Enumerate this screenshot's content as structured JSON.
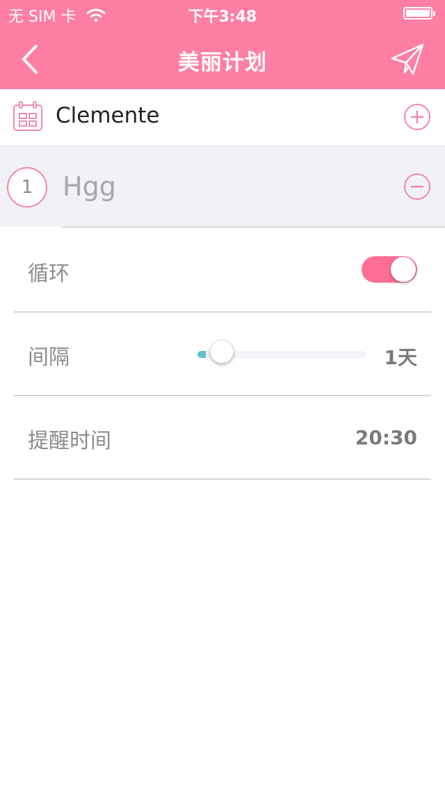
{
  "status_bar": {
    "carrier": "无 SIM 卡",
    "time": "下午3:48",
    "wifi_icon": "wifi-icon",
    "battery_icon": "battery-icon"
  },
  "nav": {
    "title": "美丽计划",
    "back_icon": "chevron-left-icon",
    "send_icon": "paper-plane-icon"
  },
  "plan": {
    "name": "Clemente",
    "icon": "calendar-icon",
    "add_icon": "plus-circle-icon"
  },
  "item": {
    "index": "1",
    "name": "Hgg",
    "remove_icon": "minus-circle-icon"
  },
  "settings": {
    "loop": {
      "label": "循环",
      "enabled": true
    },
    "interval": {
      "label": "间隔",
      "value": "1天",
      "slider_level": 0.05
    },
    "reminder": {
      "label": "提醒时间",
      "value": "20:30"
    }
  },
  "colors": {
    "brand": "#ff7fa2",
    "toggle_on": "#fe6e95",
    "slider_fill": "#5bc0c8",
    "accent_outline": "#f087a6"
  }
}
